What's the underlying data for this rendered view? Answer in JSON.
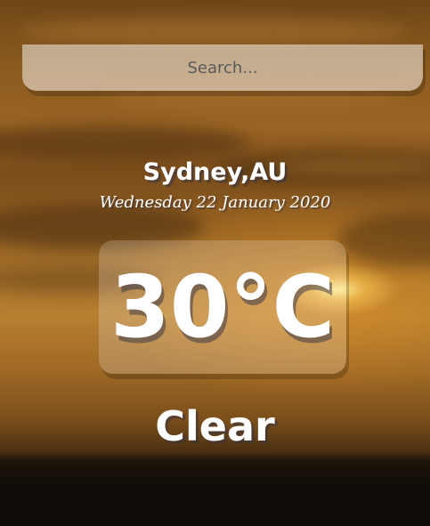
{
  "search": {
    "placeholder": "Search...",
    "value": ""
  },
  "location": {
    "city": "Sydney,AU",
    "date": "Wednesday 22 January 2020"
  },
  "weather": {
    "temperature": "30°C",
    "condition": "Clear"
  },
  "colors": {
    "text": "#ffffff",
    "search_background": "rgba(255,255,255,0.5)",
    "temp_box_background": "rgba(255,255,255,0.2)",
    "sky_primary": "#a4702a",
    "sun_glow": "#ffee96"
  },
  "background": {
    "theme": "warm-sunset-sky"
  }
}
